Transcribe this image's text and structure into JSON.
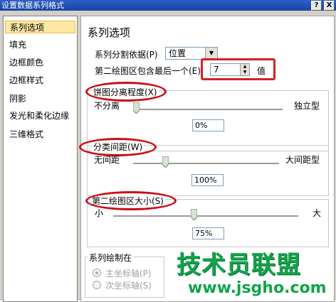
{
  "window": {
    "title": "设置数据系列格式",
    "help_glyph": "?",
    "close_glyph": "X"
  },
  "sidebar": {
    "items": [
      {
        "label": "系列选项",
        "selected": true
      },
      {
        "label": "填充"
      },
      {
        "label": "边框颜色"
      },
      {
        "label": "边框样式"
      },
      {
        "label": "阴影"
      },
      {
        "label": "发光和柔化边缘"
      },
      {
        "label": "三维格式"
      }
    ]
  },
  "main": {
    "heading": "系列选项",
    "split_by": {
      "label": "系列分割依据(P)",
      "value": "位置"
    },
    "second_plot": {
      "label": "第二绘图区包含最后一个(E)",
      "value": "7",
      "unit": "值"
    },
    "pie_explosion": {
      "label": "饼图分离程度(X)",
      "left": "不分离",
      "right": "独立型",
      "value": "0%",
      "fraction": 0.0
    },
    "gap_width": {
      "label": "分类间距(W)",
      "left": "无间距",
      "right": "大间距型",
      "value": "100%",
      "fraction": 0.2
    },
    "second_plot_size": {
      "label": "第二绘图区大小(S)",
      "left": "小",
      "right": "大",
      "value": "75%",
      "fraction": 0.42
    },
    "plot_on": {
      "label": "系列绘制在",
      "options": [
        {
          "label": "主坐标轴(P)",
          "checked": true
        },
        {
          "label": "次坐标轴(S)",
          "checked": false
        }
      ]
    }
  },
  "watermark": {
    "text": "技术员联盟",
    "url": "www.jsgho.com"
  },
  "colors": {
    "annotation_red": "#d61f26",
    "selected_bg": "#fde7a3",
    "watermark_green": "#12a34a"
  }
}
